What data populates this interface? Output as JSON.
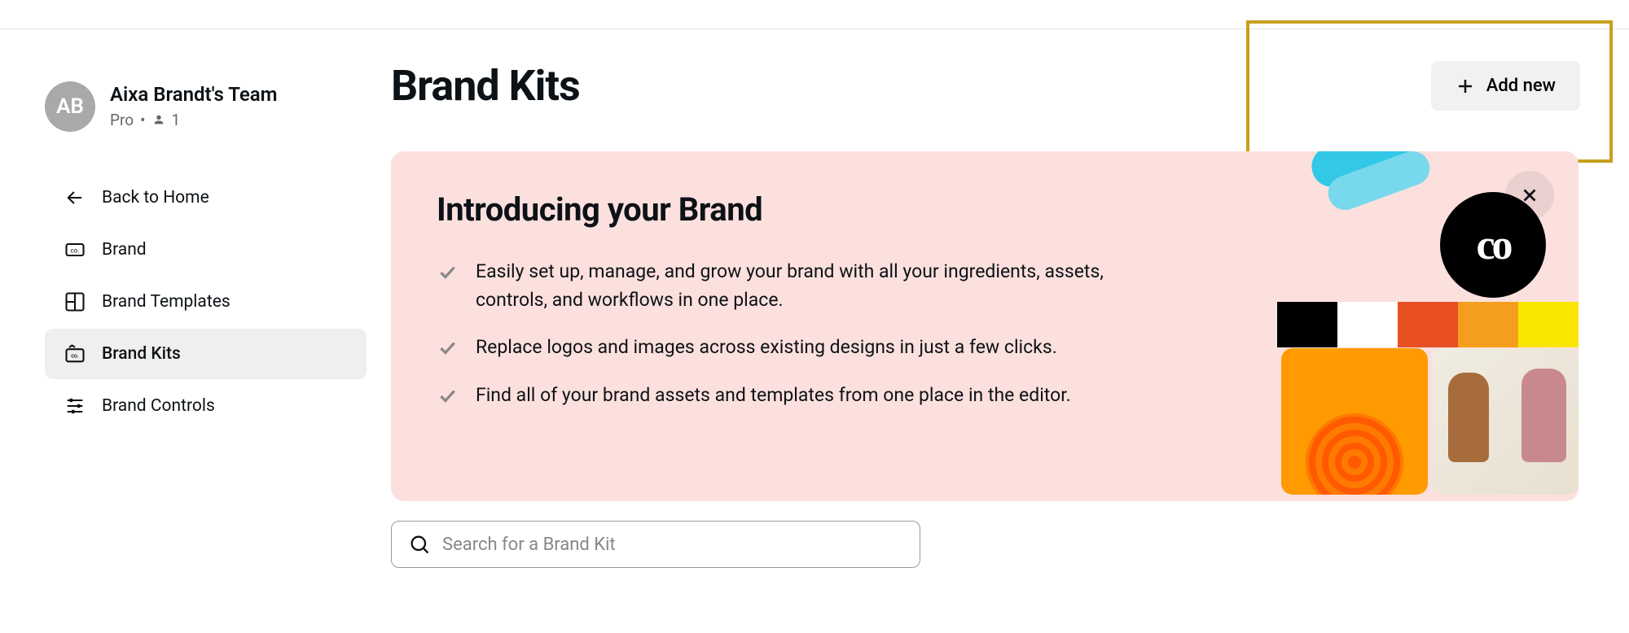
{
  "sidebar": {
    "avatar_initials": "AB",
    "team_name": "Aixa Brandt's Team",
    "plan": "Pro",
    "member_count": "1",
    "nav": {
      "back": "Back to Home",
      "brand": "Brand",
      "templates": "Brand Templates",
      "kits": "Brand Kits",
      "controls": "Brand Controls"
    }
  },
  "page": {
    "title": "Brand Kits",
    "add_new": "Add new"
  },
  "intro": {
    "heading": "Introducing your Brand",
    "items": [
      "Easily set up, manage, and grow your brand with all your ingredients, assets, controls, and workflows in one place.",
      "Replace logos and images across existing designs in just a few clicks.",
      "Find all of your brand assets and templates from one place in the editor."
    ],
    "logo_text": "co"
  },
  "search": {
    "placeholder": "Search for a Brand Kit"
  },
  "swatch_colors": [
    "#000000",
    "#ffffff",
    "#e84f22",
    "#f59e1d",
    "#f9e600"
  ]
}
